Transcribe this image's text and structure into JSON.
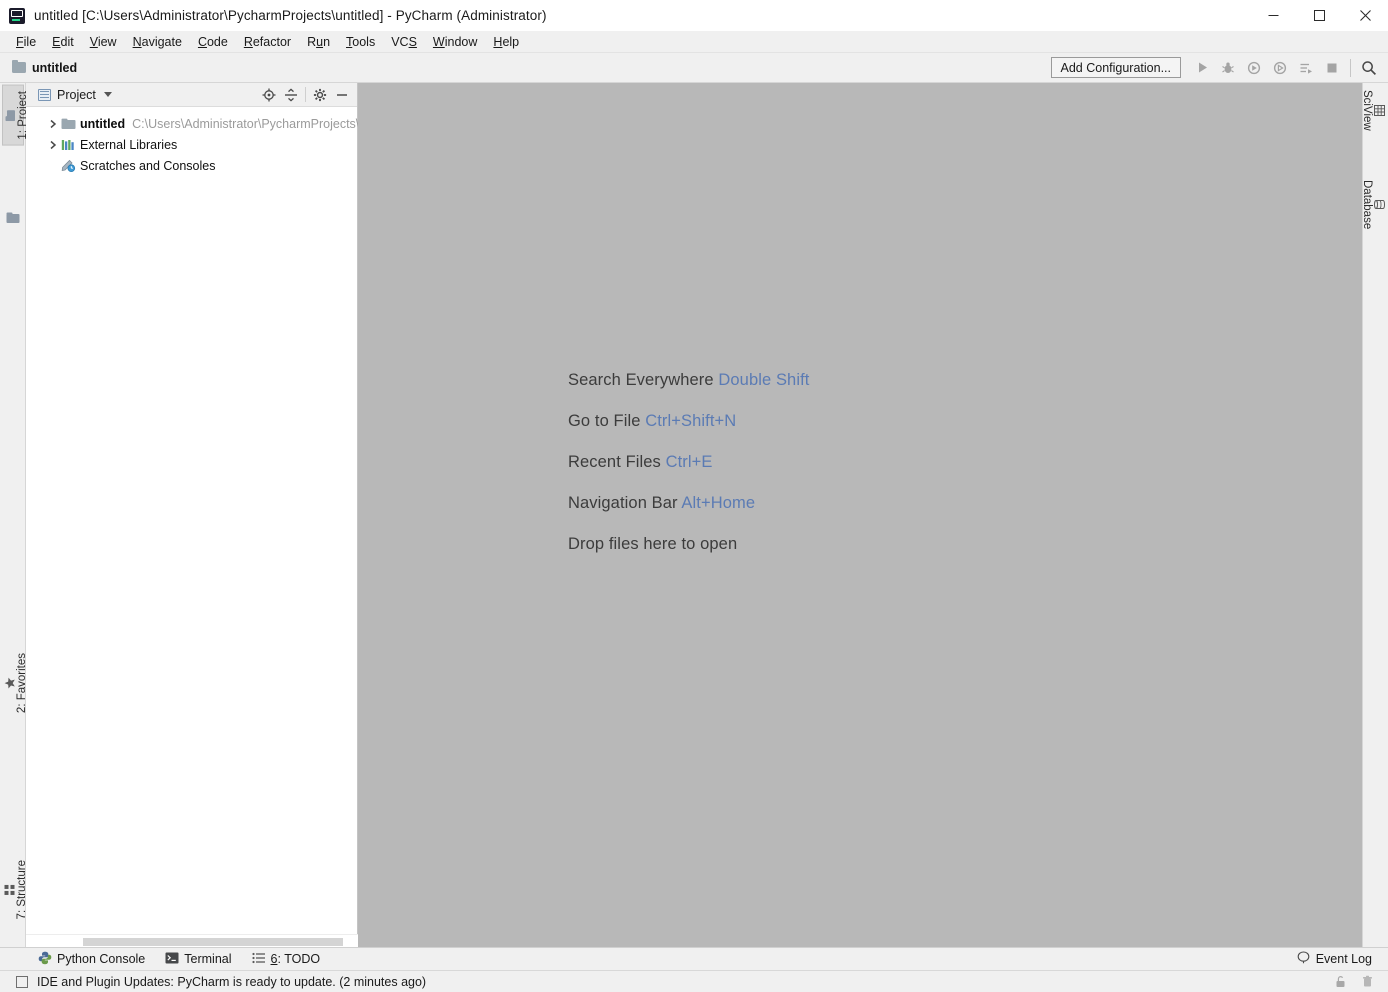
{
  "window": {
    "title": "untitled [C:\\Users\\Administrator\\PycharmProjects\\untitled] - PyCharm (Administrator)",
    "app_icon": "pycharm-logo-icon",
    "controls": {
      "minimize": "minimize-icon",
      "maximize": "maximize-icon",
      "close": "close-icon"
    }
  },
  "menubar": {
    "items": [
      {
        "label": "File",
        "mnemonic": "F"
      },
      {
        "label": "Edit",
        "mnemonic": "E"
      },
      {
        "label": "View",
        "mnemonic": "V"
      },
      {
        "label": "Navigate",
        "mnemonic": "N"
      },
      {
        "label": "Code",
        "mnemonic": "C"
      },
      {
        "label": "Refactor",
        "mnemonic": "R"
      },
      {
        "label": "Run",
        "mnemonic": "u"
      },
      {
        "label": "Tools",
        "mnemonic": "T"
      },
      {
        "label": "VCS",
        "mnemonic": "S"
      },
      {
        "label": "Window",
        "mnemonic": "W"
      },
      {
        "label": "Help",
        "mnemonic": "H"
      }
    ]
  },
  "navbar": {
    "breadcrumb": "untitled",
    "breadcrumb_icon": "folder-icon"
  },
  "toolbar": {
    "config_label": "Add Configuration...",
    "buttons": [
      {
        "name": "run-button",
        "icon": "play-icon",
        "enabled": false
      },
      {
        "name": "debug-button",
        "icon": "bug-icon",
        "enabled": false
      },
      {
        "name": "run-with-coverage-button",
        "icon": "coverage-icon",
        "enabled": false
      },
      {
        "name": "profile-button",
        "icon": "profile-icon",
        "enabled": false
      },
      {
        "name": "attach-button",
        "icon": "attach-process-icon",
        "enabled": false
      },
      {
        "name": "stop-button",
        "icon": "stop-icon",
        "enabled": false
      },
      {
        "name": "search-button",
        "icon": "search-icon",
        "enabled": true
      }
    ]
  },
  "left_strip": {
    "tabs": [
      {
        "label": "1: Project",
        "selected": true,
        "icon": "project-icon"
      },
      {
        "label": "2: Favorites",
        "selected": false,
        "icon": "star-icon"
      },
      {
        "label": "7: Structure",
        "selected": false,
        "icon": "structure-icon"
      }
    ]
  },
  "right_strip": {
    "tabs": [
      {
        "label": "SciView",
        "icon": "sciview-icon"
      },
      {
        "label": "Database",
        "icon": "database-icon"
      }
    ]
  },
  "project_panel": {
    "title": "Project",
    "title_icon": "project-view-icon",
    "tools": [
      {
        "name": "scroll-from-source-button",
        "icon": "target-icon"
      },
      {
        "name": "collapse-all-button",
        "icon": "collapse-all-icon"
      },
      {
        "name": "settings-button",
        "icon": "gear-icon"
      },
      {
        "name": "hide-panel-button",
        "icon": "minimize-icon"
      }
    ],
    "tree": [
      {
        "label": "untitled",
        "path": "C:\\Users\\Administrator\\PycharmProjects\\",
        "icon": "folder-icon",
        "expandable": true,
        "expanded": false,
        "bold": true
      },
      {
        "label": "External Libraries",
        "path": "",
        "icon": "libraries-icon",
        "expandable": true,
        "expanded": false,
        "bold": false
      },
      {
        "label": "Scratches and Consoles",
        "path": "",
        "icon": "scratches-icon",
        "expandable": false,
        "expanded": false,
        "bold": false
      }
    ]
  },
  "editor": {
    "background_color": "#b8b8b8",
    "hints": [
      {
        "text": "Search Everywhere",
        "shortcut": "Double Shift"
      },
      {
        "text": "Go to File",
        "shortcut": "Ctrl+Shift+N"
      },
      {
        "text": "Recent Files",
        "shortcut": "Ctrl+E"
      },
      {
        "text": "Navigation Bar",
        "shortcut": "Alt+Home"
      },
      {
        "text": "Drop files here to open",
        "shortcut": ""
      }
    ],
    "hint_text_color": "#3c3c3c",
    "hint_key_color": "#5b7bb4"
  },
  "bottom_tabs": [
    {
      "label": "Python Console",
      "icon": "python-icon",
      "mnemonic": ""
    },
    {
      "label": "Terminal",
      "icon": "terminal-icon",
      "mnemonic": ""
    },
    {
      "label": "6: TODO",
      "icon": "todo-icon",
      "mnemonic": "6"
    }
  ],
  "event_log": {
    "label": "Event Log",
    "icon": "balloon-icon"
  },
  "statusbar": {
    "icon": "notification-icon",
    "message": "IDE and Plugin Updates: PyCharm is ready to update. (2 minutes ago)",
    "right_icons": [
      {
        "name": "lock-icon"
      },
      {
        "name": "memory-trash-icon"
      }
    ]
  }
}
